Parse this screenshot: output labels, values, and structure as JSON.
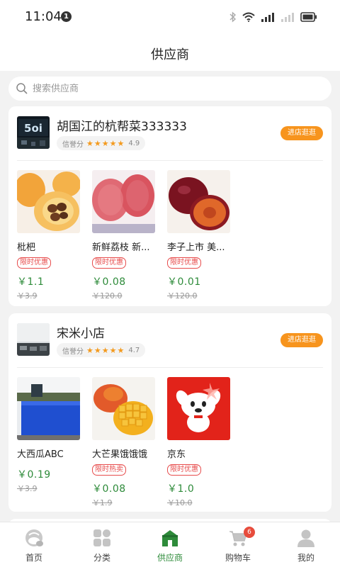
{
  "status": {
    "time": "11:04",
    "notification_count": "1"
  },
  "header": {
    "title": "供应商"
  },
  "search": {
    "placeholder": "搜索供应商"
  },
  "suppliers": [
    {
      "name": "胡国江的杭帮菜333333",
      "rating_label": "信誉分",
      "rating": "4.9",
      "visit_label": "进店逛逛",
      "products": [
        {
          "name": "枇杷",
          "tag": "限时优惠",
          "price": "￥1.1",
          "old_price": "￥3.9"
        },
        {
          "name": "新鲜荔枝 新...",
          "tag": "限时优惠",
          "price": "￥0.08",
          "old_price": "￥120.0"
        },
        {
          "name": "李子上市 美...",
          "tag": "限时优惠",
          "price": "￥0.01",
          "old_price": "￥120.0"
        }
      ]
    },
    {
      "name": "宋米小店",
      "rating_label": "信誉分",
      "rating": "4.7",
      "visit_label": "进店逛逛",
      "products": [
        {
          "name": "大西瓜ABC",
          "tag": "",
          "price": "￥0.19",
          "old_price": "￥3.9"
        },
        {
          "name": "大芒果饿饿饿",
          "tag": "限时热卖",
          "price": "￥0.08",
          "old_price": "￥1.9"
        },
        {
          "name": "京东",
          "tag": "限时优惠",
          "price": "￥1.0",
          "old_price": "￥10.0"
        }
      ]
    }
  ],
  "tabbar": {
    "items": [
      {
        "label": "首页",
        "icon": "home-icon"
      },
      {
        "label": "分类",
        "icon": "category-icon"
      },
      {
        "label": "供应商",
        "icon": "supplier-icon"
      },
      {
        "label": "购物车",
        "icon": "cart-icon"
      },
      {
        "label": "我的",
        "icon": "profile-icon"
      }
    ],
    "active": "供应商",
    "cart_badge": "6"
  },
  "colors": {
    "accent": "#2e8b3a",
    "button": "#f7941d",
    "tag": "#e74c4c",
    "star": "#f39a1e"
  }
}
